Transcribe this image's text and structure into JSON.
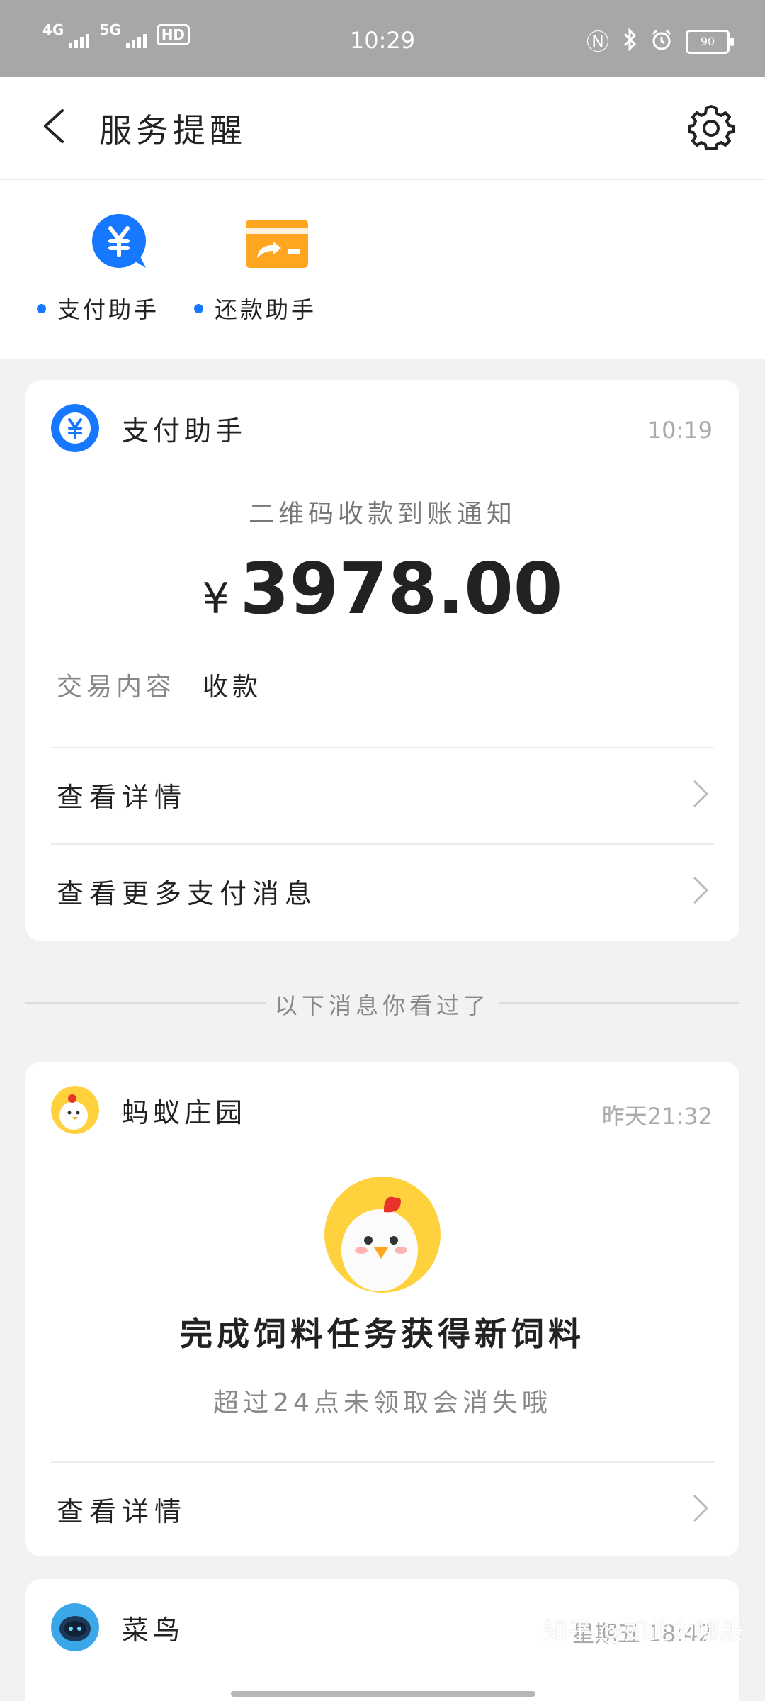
{
  "status_bar": {
    "time": "10:29",
    "net1": "4G",
    "net2": "5G",
    "hd": "HD",
    "battery": "90"
  },
  "header": {
    "title": "服务提醒"
  },
  "quick_entries": [
    {
      "label": "支付助手"
    },
    {
      "label": "还款助手"
    }
  ],
  "payment_card": {
    "name": "支付助手",
    "time": "10:19",
    "notice_title": "二维码收款到账通知",
    "currency": "¥",
    "amount": "3978.00",
    "field_label": "交易内容",
    "field_value": "收款",
    "action1": "查看详情",
    "action2": "查看更多支付消息"
  },
  "separator_text": "以下消息你看过了",
  "farm_card": {
    "name": "蚂蚁庄园",
    "time": "昨天21:32",
    "headline": "完成饲料任务获得新饲料",
    "subtext": "超过24点未领取会消失哦",
    "action": "查看详情"
  },
  "cainiao_card": {
    "name": "菜鸟",
    "time": "星期五 18:42"
  },
  "watermark": "知乎 @如此为哪般",
  "colors": {
    "accent_blue": "#1677ff",
    "orange": "#ffa51f",
    "status_bar_bg": "#a7a7a7",
    "page_bg": "#f2f2f2"
  }
}
